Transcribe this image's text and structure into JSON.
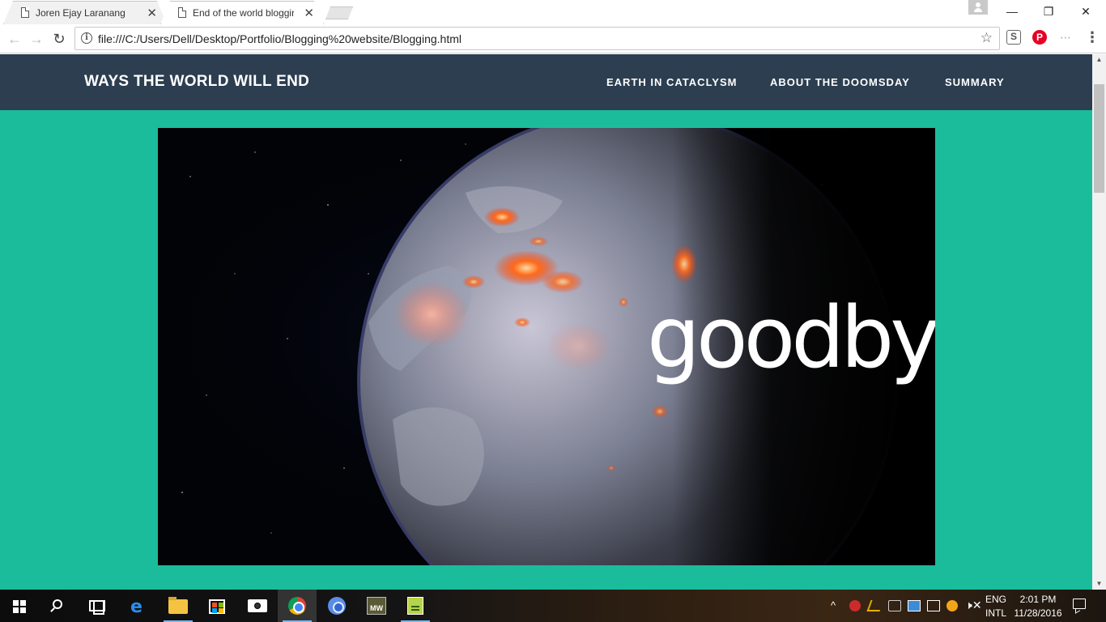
{
  "browser": {
    "tabs": [
      {
        "title": "Joren Ejay Laranang",
        "active": false
      },
      {
        "title": "End of the world bloggin",
        "active": true
      }
    ],
    "close_glyph": "✕",
    "window_controls": {
      "minimize": "—",
      "restore": "❐",
      "close": "✕"
    },
    "back_glyph": "←",
    "forward_glyph": "→",
    "reload_glyph": "↻",
    "info_glyph": "i",
    "url": "file:///C:/Users/Dell/Desktop/Portfolio/Blogging%20website/Blogging.html",
    "star_glyph": "☆",
    "extensions": [
      "S",
      "P",
      "⋯"
    ],
    "menu_glyph": "⋮"
  },
  "site": {
    "brand": "WAYS THE WORLD WILL END",
    "nav": [
      "EARTH IN CATACLYSM",
      "ABOUT THE DOOMSDAY",
      "SUMMARY"
    ],
    "hero_text": "goodbye",
    "colors": {
      "page_bg": "#1abc9c",
      "nav_bg": "#2c3e50",
      "text": "#ffffff"
    }
  },
  "scrollbar": {
    "up": "▲",
    "down": "▼",
    "position": 0.06
  },
  "taskbar": {
    "tray": {
      "chevron": "^",
      "lang_top": "ENG",
      "lang_bottom": "INTL",
      "time": "2:01 PM",
      "date": "11/28/2016",
      "mw_label": "MW"
    }
  }
}
